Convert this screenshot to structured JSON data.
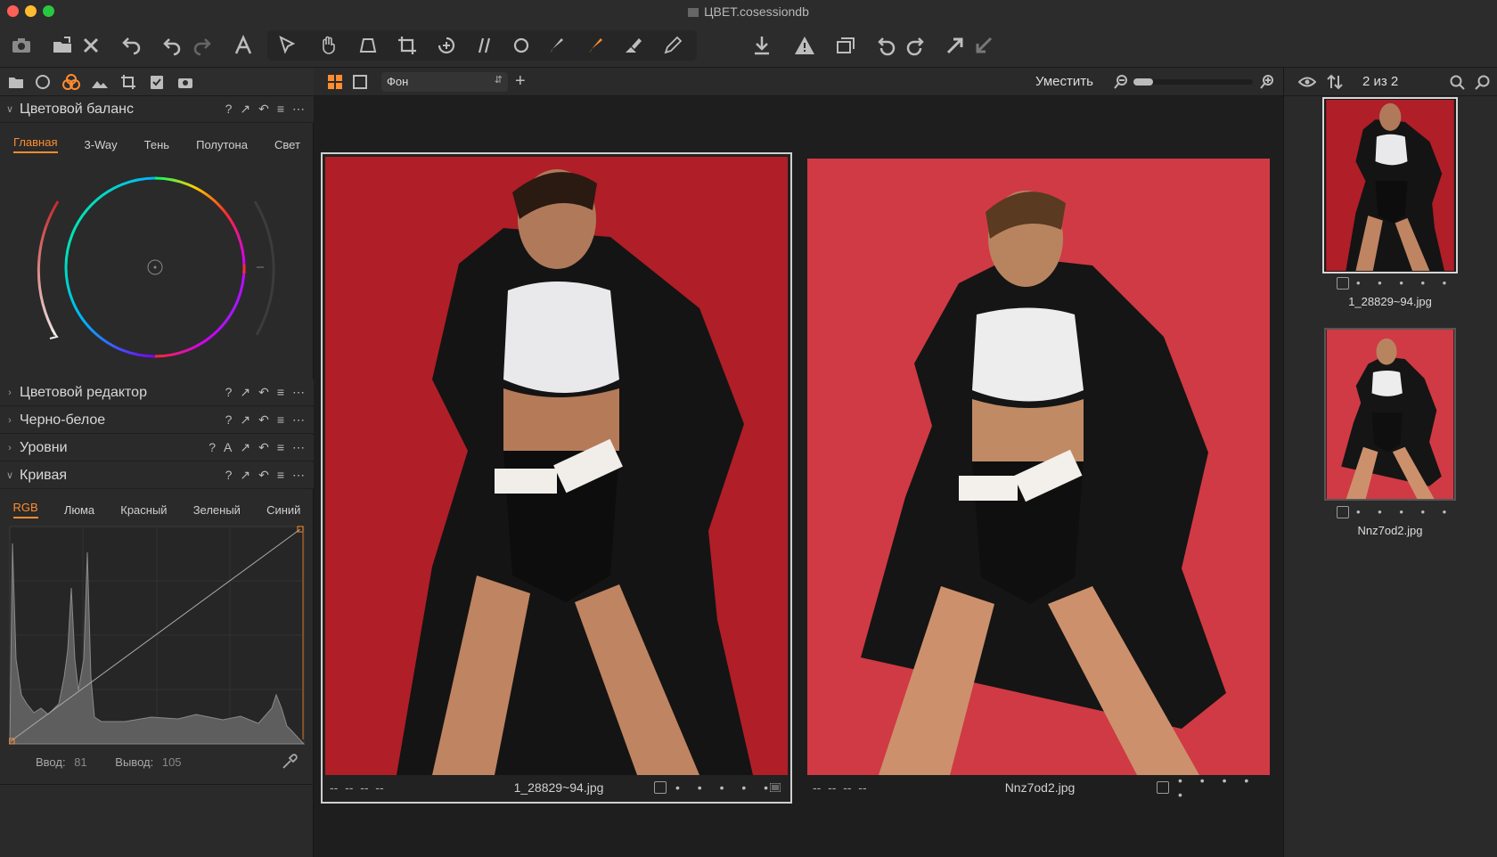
{
  "window": {
    "title": "ЦВЕТ.cosessiondb"
  },
  "colors": {
    "accent": "#ff8c2e",
    "close": "#ff5f57",
    "minimize": "#febc2e",
    "zoom": "#28c840",
    "photo_bg": "#b81f2a"
  },
  "toolbar": {
    "icons": [
      "camera-icon",
      "import-icon",
      "delete-icon",
      "undo-all-icon",
      "undo-icon",
      "redo-icon",
      "text-icon",
      "select-icon",
      "pan-icon",
      "keystone-icon",
      "crop-icon",
      "rotate-icon",
      "straighten-icon",
      "circle-mask-icon",
      "brush-icon",
      "mask-brush-icon",
      "eraser-icon",
      "pen-icon",
      "export-icon",
      "warning-icon",
      "copies-icon",
      "rotate-left-icon",
      "rotate-right-icon",
      "copy-adjustments-icon",
      "apply-adjustments-icon"
    ]
  },
  "left": {
    "tab_icons": [
      "library-icon",
      "capture-icon",
      "color-icon",
      "exposure-icon",
      "lens-icon",
      "metadata-icon",
      "output-icon"
    ],
    "color_balance": {
      "title": "Цветовой баланс",
      "tabs": [
        "Главная",
        "3-Way",
        "Тень",
        "Полутона",
        "Свет"
      ],
      "active_tab": "Главная"
    },
    "sections": [
      {
        "title": "Цветовой редактор"
      },
      {
        "title": "Черно-белое"
      },
      {
        "title": "Уровни",
        "extra": "A"
      },
      {
        "title": "Кривая"
      }
    ],
    "curve": {
      "tabs": [
        "RGB",
        "Люма",
        "Красный",
        "Зеленый",
        "Синий"
      ],
      "active_tab": "RGB",
      "input_label": "Ввод:",
      "input_value": "81",
      "output_label": "Вывод:",
      "output_value": "105"
    }
  },
  "viewer": {
    "background_select": "Фон",
    "fit_label": "Уместить",
    "images": [
      {
        "filename": "1_28829~94.jpg",
        "placeholders": "--  --  --  --",
        "selected": true
      },
      {
        "filename": "Nnz7od2.jpg",
        "placeholders": "--  --  --  --",
        "selected": false
      }
    ],
    "rating_dots": "• • • • •"
  },
  "browser": {
    "count": "2 из 2",
    "items": [
      {
        "filename": "1_28829~94.jpg",
        "selected": true
      },
      {
        "filename": "Nnz7od2.jpg",
        "selected": false
      }
    ]
  }
}
